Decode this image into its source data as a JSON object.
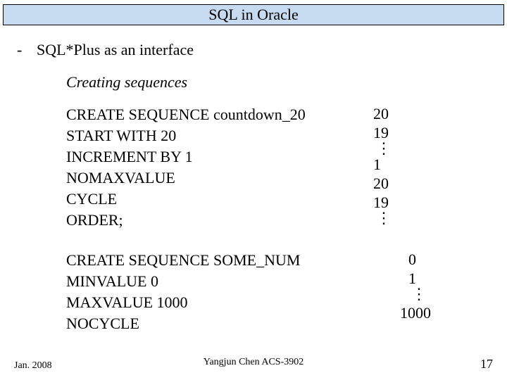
{
  "title": "SQL in Oracle",
  "dash": "-",
  "heading": "SQL*Plus as an interface",
  "subheading": "Creating sequences",
  "block1": {
    "l1": "CREATE SEQUENCE countdown_20",
    "l2": "START WITH 20",
    "l3": "INCREMENT BY 1",
    "l4": "NOMAXVALUE",
    "l5": "CYCLE",
    "l6": "ORDER;"
  },
  "seq1": {
    "a": "20",
    "b": "19",
    "dots1": "⋮",
    "c": "1",
    "d": "20",
    "e": "19",
    "dots2": "⋮"
  },
  "block2": {
    "l1": "CREATE SEQUENCE SOME_NUM",
    "l2": "MINVALUE 0",
    "l3": "MAXVALUE 1000",
    "l4": "NOCYCLE"
  },
  "seq2": {
    "a": "0",
    "b": "1",
    "dots": "⋮",
    "c": "1000"
  },
  "footer": {
    "left": "Jan. 2008",
    "center": "Yangjun Chen      ACS-3902",
    "right": "17"
  }
}
